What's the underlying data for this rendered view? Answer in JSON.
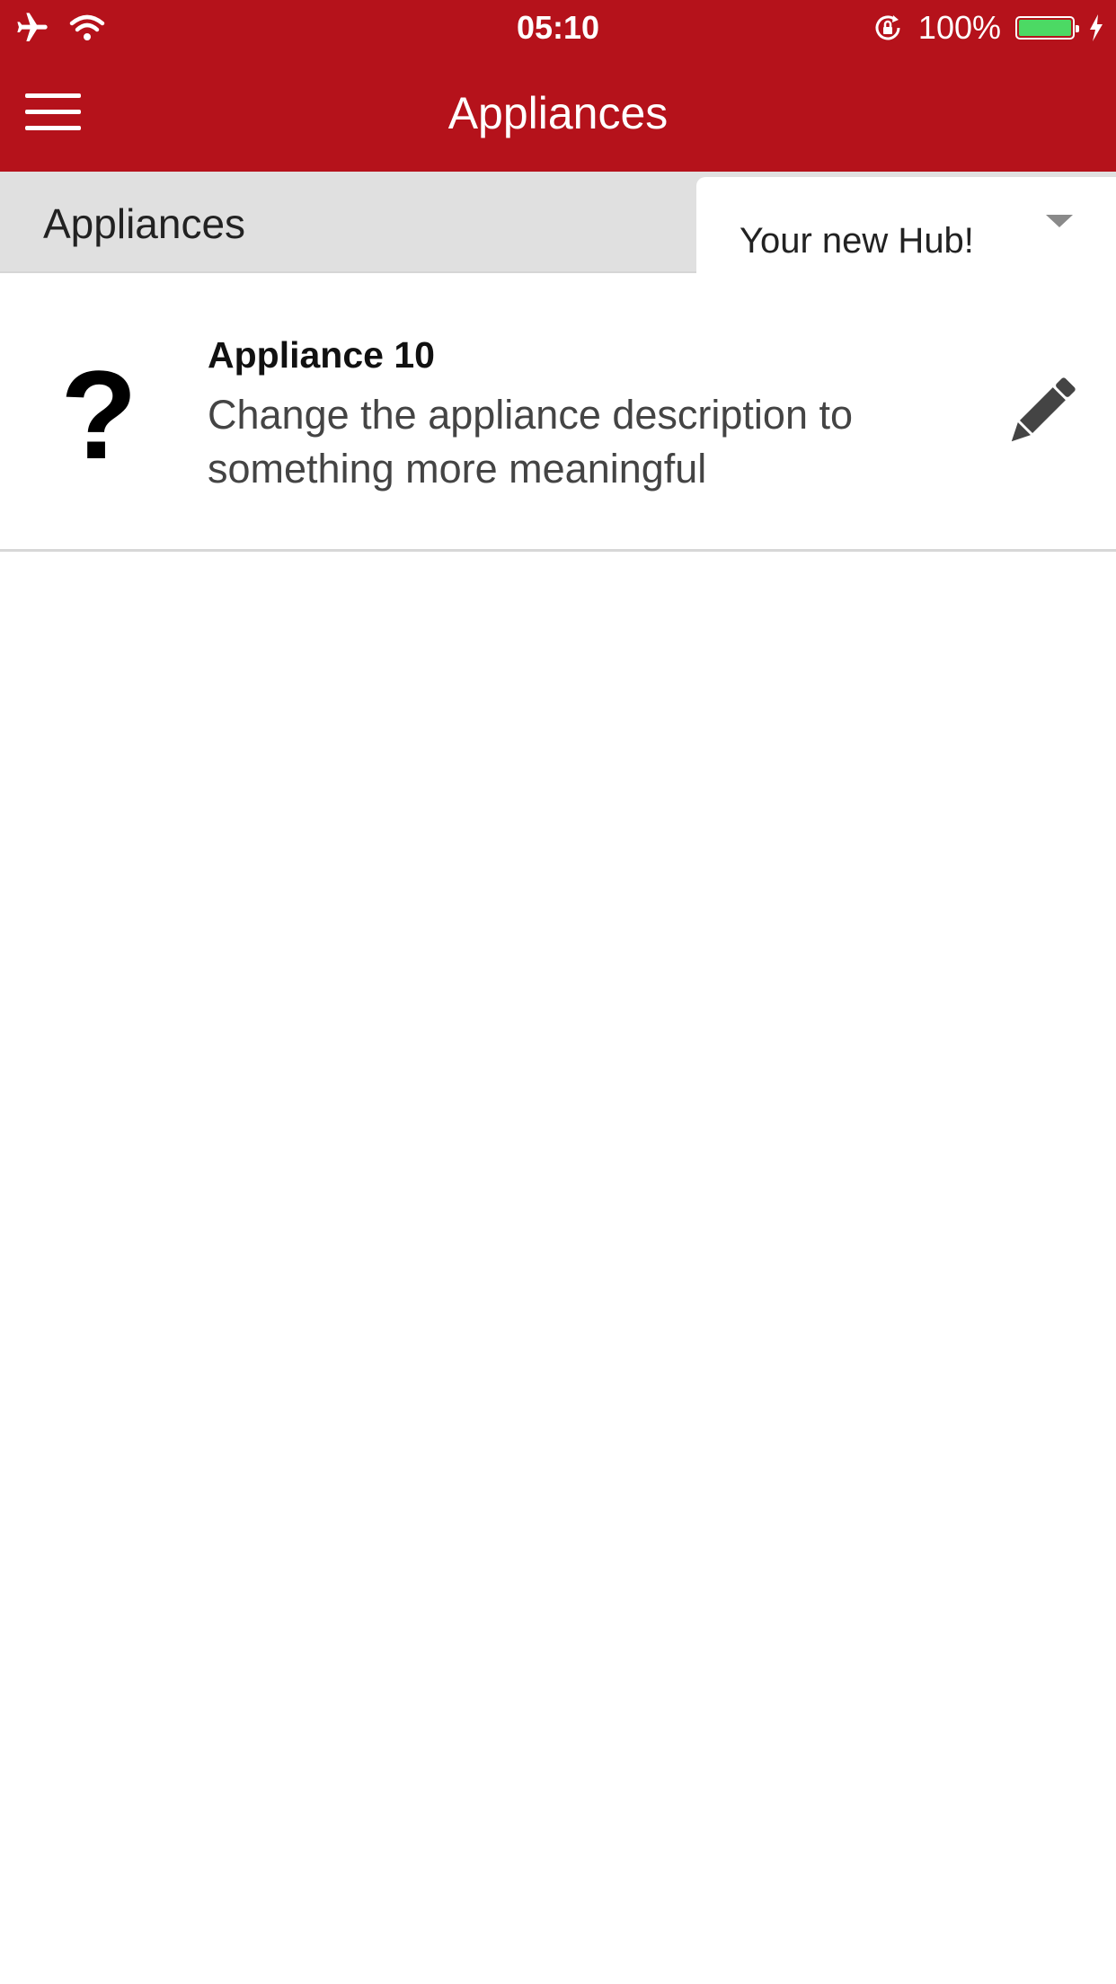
{
  "status_bar": {
    "time": "05:10",
    "battery_text": "100%",
    "battery_level": 1.0,
    "icons": [
      "airplane-icon",
      "wifi-icon",
      "rotation-lock-icon",
      "battery-icon",
      "charging-bolt-icon"
    ],
    "battery_color": "#4cd964"
  },
  "nav": {
    "title": "Appliances",
    "menu_icon": "hamburger-menu-icon",
    "bar_color": "#b5121b"
  },
  "subheader": {
    "title": "Appliances",
    "hub_selector": {
      "selected": "Your new Hub!",
      "icon": "caret-down-icon"
    }
  },
  "appliances": [
    {
      "name": "Appliance 10",
      "description": "Change the appliance description to something more meaningful",
      "icon": "question-mark-icon",
      "icon_glyph": "?",
      "action_icon": "pencil-edit-icon"
    }
  ]
}
